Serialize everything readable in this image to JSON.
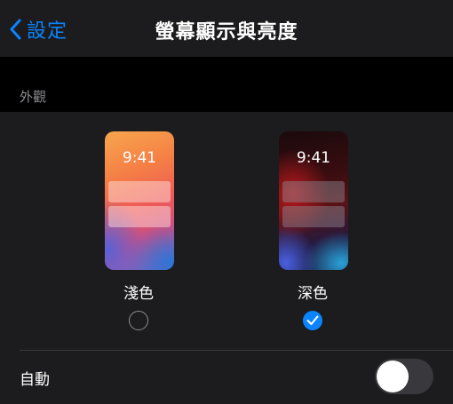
{
  "nav": {
    "back_label": "設定",
    "title": "螢幕顯示與亮度"
  },
  "appearance": {
    "section_title": "外觀",
    "options": [
      {
        "label": "淺色",
        "time": "9:41",
        "selected": false
      },
      {
        "label": "深色",
        "time": "9:41",
        "selected": true
      }
    ]
  },
  "automatic": {
    "label": "自動",
    "enabled": false
  },
  "colors": {
    "accent": "#0a84ff",
    "background": "#000000",
    "group_background": "#1c1c1e",
    "secondary_text": "#8e8e93"
  },
  "icons": {
    "back": "chevron-left-icon",
    "check": "checkmark-icon"
  }
}
